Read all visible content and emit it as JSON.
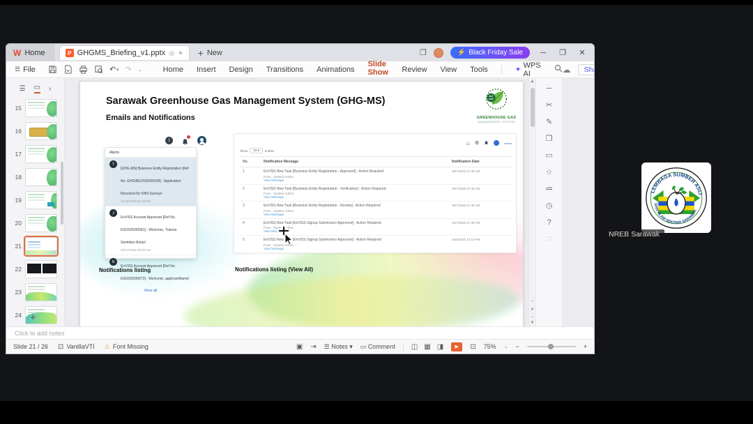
{
  "meeting": {
    "participant_label": "NREB Sarawak",
    "logo_arc_top": "LEMBAGA SUMBER ASLI",
    "logo_arc_bottom": "DAN ALAM SEKITAR SARAWAK"
  },
  "titlebar": {
    "home_tab": "Home",
    "doc_tab": "GHGMS_Briefing_v1.pptx",
    "new_label": "New",
    "promo_label": "Black Friday Sale"
  },
  "menubar": {
    "file_label": "File",
    "items": [
      {
        "label": "Home"
      },
      {
        "label": "Insert"
      },
      {
        "label": "Design"
      },
      {
        "label": "Transitions"
      },
      {
        "label": "Animations"
      },
      {
        "label": "Slide Show"
      },
      {
        "label": "Review"
      },
      {
        "label": "View"
      },
      {
        "label": "Tools"
      }
    ],
    "wps_ai_label": "WPS AI",
    "share_label": "Share"
  },
  "sidebar": {
    "slides": [
      {
        "number": "15"
      },
      {
        "number": "16"
      },
      {
        "number": "17"
      },
      {
        "number": "18"
      },
      {
        "number": "19"
      },
      {
        "number": "20"
      },
      {
        "number": "21"
      },
      {
        "number": "22"
      },
      {
        "number": "23"
      },
      {
        "number": "24"
      }
    ]
  },
  "slide": {
    "title": "Sarawak Greenhouse Gas Management System (GHG-MS)",
    "subtitle": "Emails and Notifications",
    "logo": {
      "badge": "NET ZERO 2050",
      "line1": "GREENHOUSE GAS",
      "line2": "MANAGEMENT SYSTEM"
    },
    "alerts": {
      "header": "Alerts",
      "items": [
        {
          "initial": "T",
          "text": "[GHG-MS] Business Entity Registration [Ref No. GHG/BE/2025/00028] - Application Received for KNN Surveys",
          "time": "21/10/2025 02:19 PM"
        },
        {
          "initial": "J",
          "text": "EnVISS Account Approved [Ref No. ES/2025/00081] - Welcome, Trainee Sembilan Belas!",
          "time": "30/07/2025 09:09 AM"
        },
        {
          "initial": "N",
          "text": "EnVISS Account Approved [Ref No. ES/2025/00072] - Welcome, applicantName!",
          "time": ""
        }
      ],
      "view_all": "View all"
    },
    "notif_page": {
      "user_name": "admin",
      "show_label": "Show",
      "show_value": "10",
      "entries_label": "entries",
      "col_no": "No.",
      "col_message": "Notification Message",
      "col_date": "Notification Date",
      "rows": [
        {
          "no": "1",
          "message": "EnVISS New Task [Business Entity Registration - Approved] - Action Required",
          "from": "From : System Admin",
          "link": "View Message",
          "date": "30/7/2025 07:49 AM"
        },
        {
          "no": "2",
          "message": "EnVISS New Task [Business Entity Registration - Verification] - Action Required",
          "from": "From : System Admin",
          "link": "View Message",
          "date": "30/7/2025 07:49 AM"
        },
        {
          "no": "3",
          "message": "EnVISS New Task [Business Entity Registration - Review] - Action Required",
          "from": "From : System Admin",
          "link": "View Message",
          "date": "30/7/2025 07:46 AM"
        },
        {
          "no": "4",
          "message": "EnVISS New Task [EnVISS Signup Submission Approved] - Action Required",
          "from": "From : System Admin",
          "link": "View Message",
          "date": "30/7/2025 07:39 AM"
        },
        {
          "no": "5",
          "message": "EnVISS New Task [EnVISS Signup Submission Approved] - Action Required",
          "from": "From : System Admin",
          "link": "View Message",
          "date": "16/6/2025 12:10 PM"
        }
      ]
    },
    "captions": {
      "left": "Notifications listing",
      "right": "Notifications listing (View All)"
    }
  },
  "notes": {
    "placeholder": "Click to add notes"
  },
  "statusbar": {
    "slide_indicator": "Slide 21 / 26",
    "theme_name": "VanillaVTI",
    "font_missing": "Font Missing",
    "notes_label": "Notes",
    "comment_label": "Comment",
    "zoom_level": "75%"
  },
  "colors": {
    "accent_orange": "#c34a21",
    "promo_gradient_from": "#3b6cff",
    "promo_gradient_to": "#8a3df0",
    "logo_green": "#2e7d32",
    "link_blue": "#4a9bd5"
  }
}
